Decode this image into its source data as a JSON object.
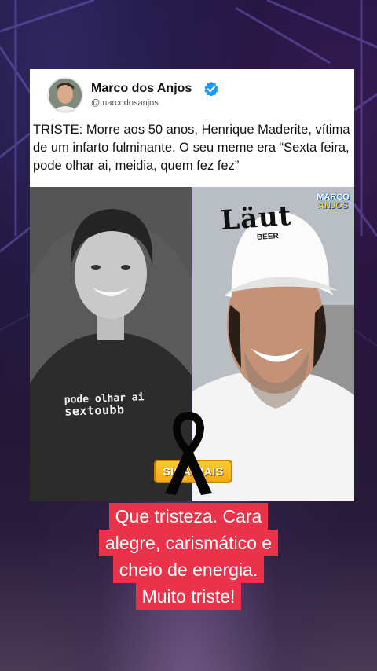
{
  "post": {
    "author_name": "Marco dos Anjos",
    "handle": "@marcodosanjos",
    "verified_icon": "verified-badge-icon",
    "text": "TRISTE: Morre aos 50 anos, Henrique Maderite, vítima de um infarto fulminante. O seu meme era “Sexta feira, pode olhar ai, meidia, quem fez fez”"
  },
  "photo_left": {
    "shirt_line1": "pode olhar ai",
    "shirt_line2": "sextou",
    "shirt_suffix": "bb"
  },
  "photo_right": {
    "cap_text": "Läut",
    "cap_subtext": "BEER",
    "logo_line1": "MARCO",
    "logo_line2": "ANJOS"
  },
  "overlay": {
    "follow_badge": "SIGA MAIS",
    "mourning_icon": "black-ribbon-icon"
  },
  "caption": {
    "lines": [
      "Que tristeza. Cara",
      "alegre, carismático e",
      "cheio de energia.",
      "Muito triste!"
    ]
  },
  "colors": {
    "caption_bg": "#e8334a",
    "verified_blue": "#1d9bf0",
    "badge_orange": "#f2a414"
  }
}
